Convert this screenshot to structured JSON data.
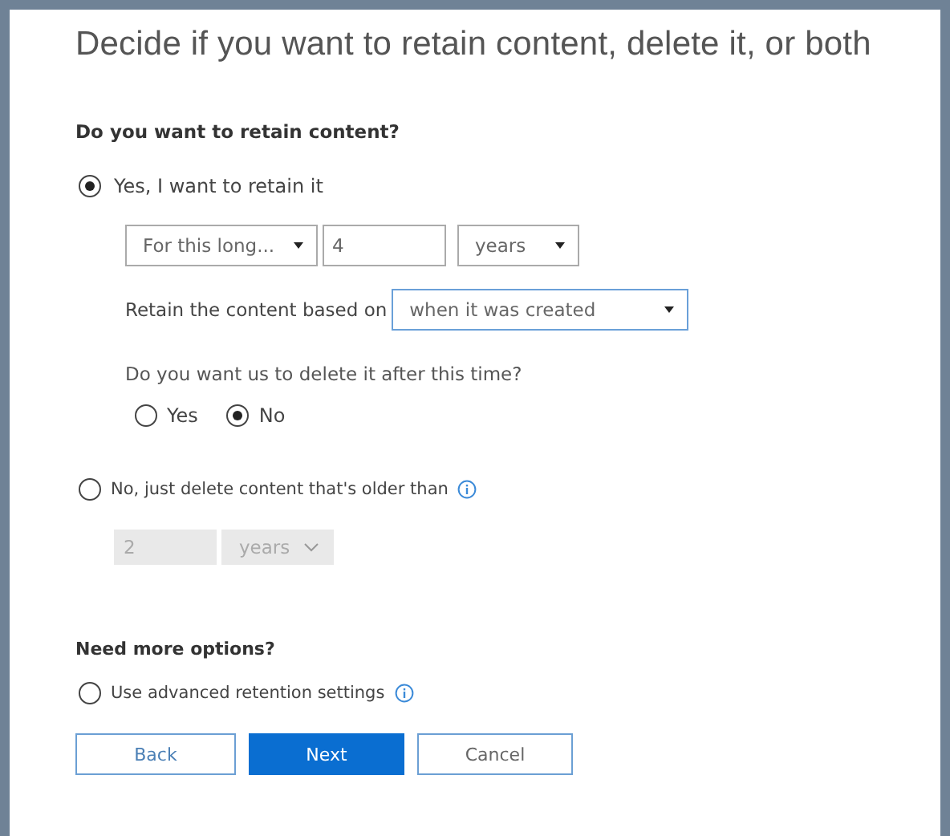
{
  "title": "Decide if you want to retain content, delete it, or both",
  "retain_heading": "Do you want to retain content?",
  "retain_option": {
    "label": "Yes, I want to retain it",
    "selected": true,
    "duration_type": "For this long...",
    "duration_value": "4",
    "duration_unit": "years",
    "based_on_label": "Retain the content based on",
    "based_on": "when it was created",
    "delete_question": "Do you want us to delete it after this time?",
    "delete_choices": [
      {
        "label": "Yes",
        "selected": false
      },
      {
        "label": "No",
        "selected": true
      }
    ]
  },
  "delete_option": {
    "label": "No, just delete content that's older than",
    "selected": false,
    "disabled_fields": true,
    "age_value": "2",
    "age_unit": "years"
  },
  "more_heading": "Need more options?",
  "advanced_option": {
    "label": "Use advanced retention settings",
    "selected": false
  },
  "buttons": [
    {
      "label": "Back",
      "kind": "secondary"
    },
    {
      "label": "Next",
      "kind": "primary"
    },
    {
      "label": "Cancel",
      "kind": "secondary"
    }
  ]
}
